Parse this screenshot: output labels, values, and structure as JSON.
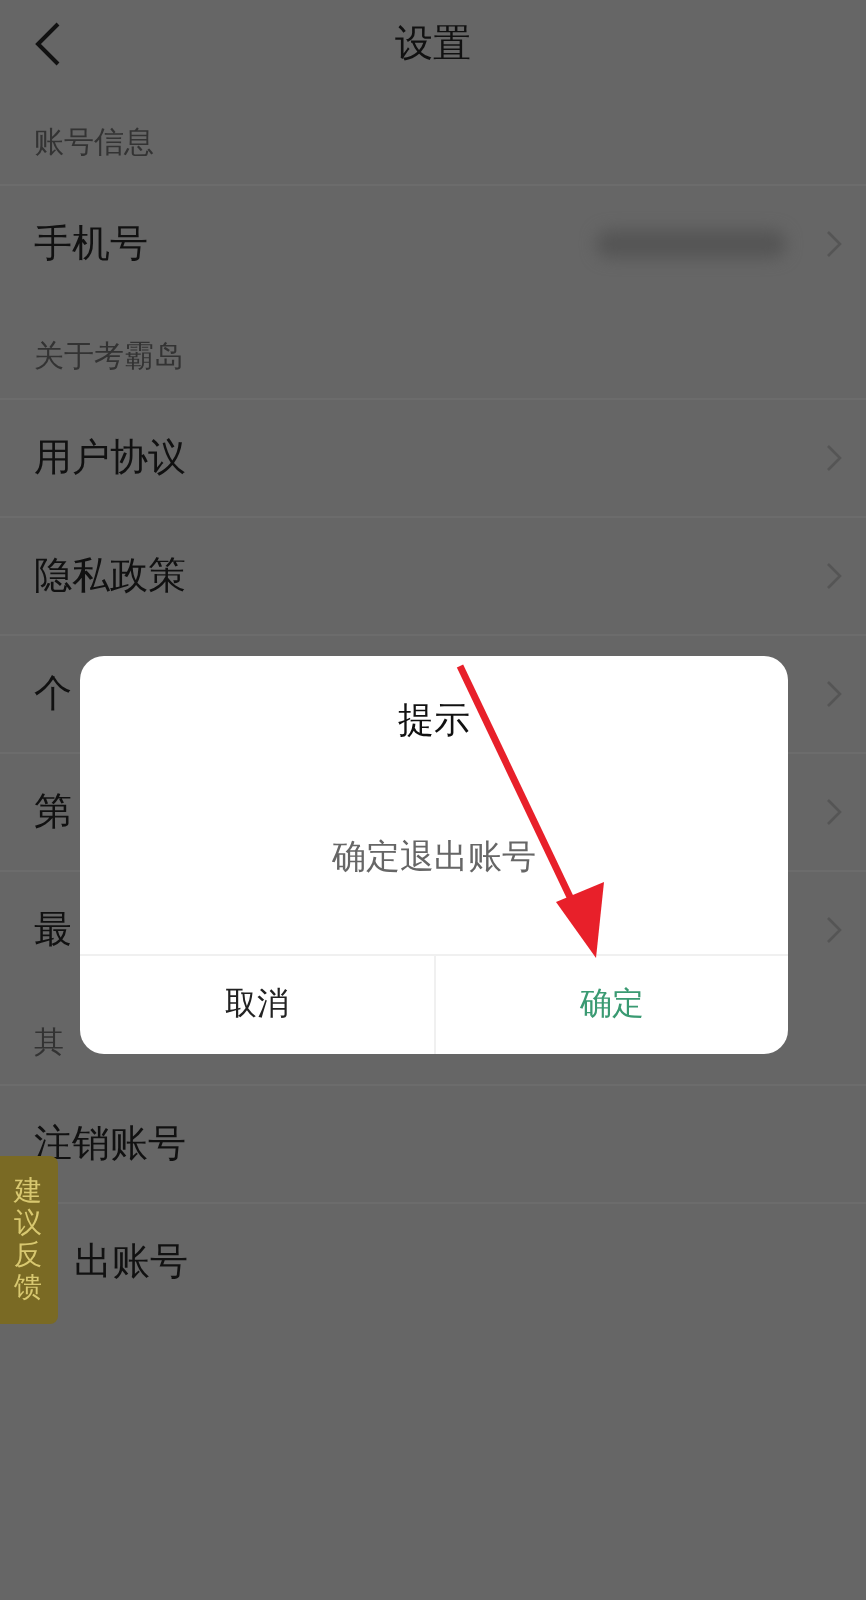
{
  "nav": {
    "title": "设置"
  },
  "sections": [
    {
      "header": "账号信息",
      "rows": [
        {
          "label": "手机号",
          "kind": "masked"
        }
      ]
    },
    {
      "header": "关于考霸岛",
      "rows": [
        {
          "label": "用户协议",
          "kind": "link"
        },
        {
          "label": "隐私政策",
          "kind": "link"
        },
        {
          "label": "个",
          "kind": "link"
        },
        {
          "label": "第",
          "kind": "link"
        },
        {
          "label": "最",
          "kind": "link"
        }
      ]
    },
    {
      "header": "其",
      "rows": [
        {
          "label": "注销账号",
          "kind": "action"
        },
        {
          "label": "出账号",
          "kind": "obscured"
        }
      ]
    }
  ],
  "feedback_tab": {
    "label": "建议反馈"
  },
  "dialog": {
    "title": "提示",
    "message": "确定退出账号",
    "buttons": [
      {
        "label": "取消",
        "kind": "cancel"
      },
      {
        "label": "确定",
        "kind": "confirm"
      }
    ]
  }
}
